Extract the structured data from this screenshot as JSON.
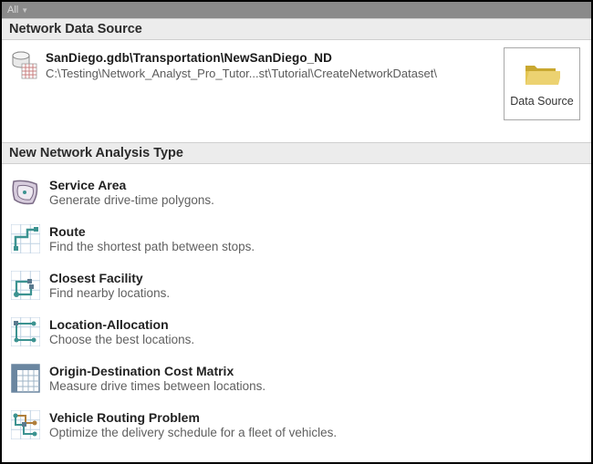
{
  "topbar": {
    "label": "All"
  },
  "sections": {
    "data_source": {
      "header": "Network Data Source",
      "name": "SanDiego.gdb\\Transportation\\NewSanDiego_ND",
      "path": "C:\\Testing\\Network_Analyst_Pro_Tutor...st\\Tutorial\\CreateNetworkDataset\\",
      "button_label": "Data Source"
    },
    "analysis": {
      "header": "New Network Analysis Type",
      "items": [
        {
          "icon": "service-area",
          "title": "Service Area",
          "desc": "Generate drive-time polygons."
        },
        {
          "icon": "route",
          "title": "Route",
          "desc": "Find the shortest path between stops."
        },
        {
          "icon": "closest",
          "title": "Closest Facility",
          "desc": "Find nearby locations."
        },
        {
          "icon": "loc-alloc",
          "title": "Location-Allocation",
          "desc": "Choose the best locations."
        },
        {
          "icon": "od-matrix",
          "title": "Origin-Destination Cost Matrix",
          "desc": "Measure drive times between locations."
        },
        {
          "icon": "vrp",
          "title": "Vehicle Routing Problem",
          "desc": "Optimize the delivery schedule for a fleet of vehicles."
        }
      ]
    }
  },
  "colors": {
    "accent": "#d4b43c",
    "grid": "#b8cde0",
    "teal": "#3c9391",
    "dark": "#5a7a8f"
  }
}
